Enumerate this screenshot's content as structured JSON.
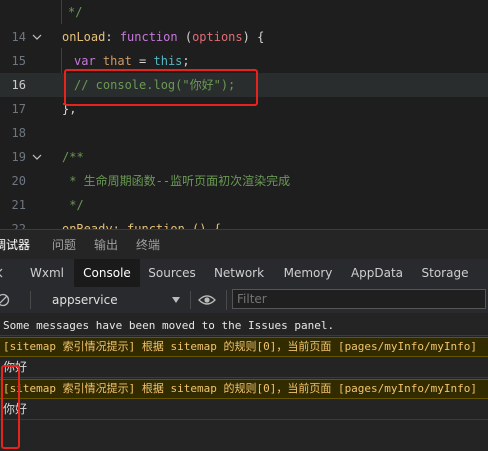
{
  "editor": {
    "lines": [
      {
        "num": "",
        "text": "*/"
      },
      {
        "num": "14",
        "key": "onLoad",
        "colon": ": ",
        "fn": "function",
        "open": " (",
        "param": "options",
        "close": ") {"
      },
      {
        "num": "15",
        "var": "var",
        "ident": " that",
        "eq": " = ",
        "this": "this",
        "semi": ";"
      },
      {
        "num": "16",
        "text": "// console.log(\"你好\");"
      },
      {
        "num": "17",
        "text": "},"
      },
      {
        "num": "18",
        "text": ""
      },
      {
        "num": "19",
        "text": "/**"
      },
      {
        "num": "20",
        "text": " * 生命周期函数--监听页面初次渲染完成"
      },
      {
        "num": "21",
        "text": " */"
      },
      {
        "num": "22",
        "text": "onReady: function () {"
      }
    ]
  },
  "devtools": {
    "top_tabs": [
      "调试器",
      "问题",
      "输出",
      "终端"
    ],
    "panel_tabs": [
      "Wxml",
      "Console",
      "Sources",
      "Network",
      "Memory",
      "AppData",
      "Storage"
    ],
    "active_panel": "Console",
    "toolbar": {
      "context": "appservice",
      "filter_placeholder": "Filter"
    },
    "console": {
      "messages": [
        {
          "type": "info",
          "text": "Some messages have been moved to the Issues panel."
        },
        {
          "type": "warn",
          "text": "[sitemap 索引情况提示] 根据 sitemap 的规则[0]，当前页面 [pages/myInfo/myInfo]"
        },
        {
          "type": "log",
          "text": "你好"
        },
        {
          "type": "warn",
          "text": "[sitemap 索引情况提示] 根据 sitemap 的规则[0]，当前页面 [pages/myInfo/myInfo]"
        },
        {
          "type": "log",
          "text": "你好"
        }
      ]
    }
  },
  "colors": {
    "highlight_box": "#e5251d",
    "warn_bg": "#332b00",
    "warn_text": "#f2c46d"
  }
}
